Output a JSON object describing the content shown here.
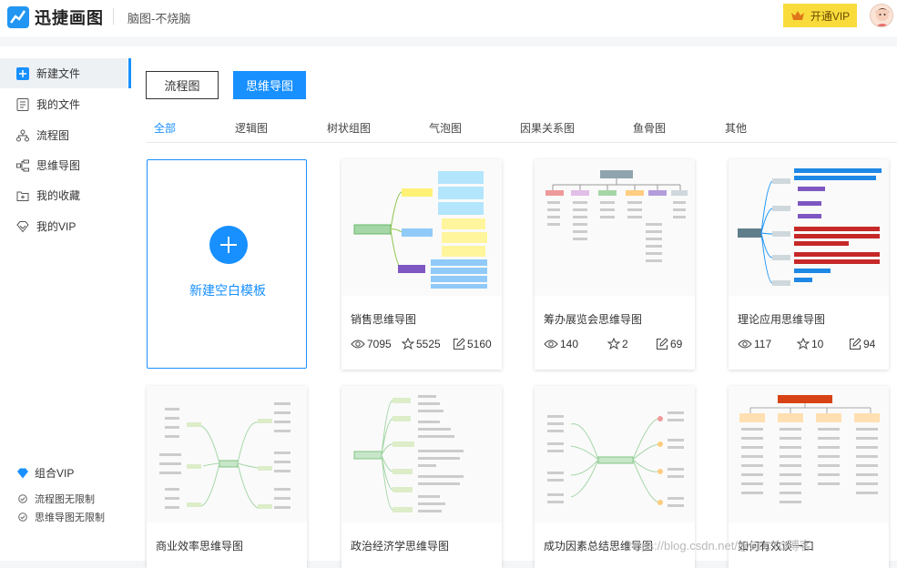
{
  "header": {
    "app_name": "迅捷画图",
    "subtitle": "脑图-不烧脑",
    "vip_label": "开通VIP"
  },
  "sidebar": {
    "items": [
      {
        "label": "新建文件",
        "icon": "new-file-icon",
        "active": true
      },
      {
        "label": "我的文件",
        "icon": "file-list-icon"
      },
      {
        "label": "流程图",
        "icon": "flowchart-icon"
      },
      {
        "label": "思维导图",
        "icon": "mindmap-icon"
      },
      {
        "label": "我的收藏",
        "icon": "favorite-icon"
      },
      {
        "label": "我的VIP",
        "icon": "vip-diamond-icon"
      }
    ],
    "combo_vip": "组合VIP",
    "features": [
      "流程图无限制",
      "思维导图无限制"
    ]
  },
  "main": {
    "type_buttons": [
      "流程图",
      "思维导图"
    ],
    "tabs": [
      "全部",
      "逻辑图",
      "树状组图",
      "气泡图",
      "因果关系图",
      "鱼骨图",
      "其他"
    ],
    "new_template_label": "新建空白模板",
    "cards": [
      {
        "title": "销售思维导图",
        "views": "7095",
        "stars": "5525",
        "edits": "5160"
      },
      {
        "title": "筹办展览会思维导图",
        "views": "140",
        "stars": "2",
        "edits": "69"
      },
      {
        "title": "理论应用思维导图",
        "views": "117",
        "stars": "10",
        "edits": "94"
      },
      {
        "title": "商业效率思维导图"
      },
      {
        "title": "政治经济学思维导图"
      },
      {
        "title": "成功因素总结思维导图"
      },
      {
        "title": "如何有效谈一口"
      }
    ]
  },
  "watermark": "https://blog.csdn.net/@51CTO博客",
  "colors": {
    "accent": "#1890ff",
    "vip": "#f9dc3c"
  }
}
